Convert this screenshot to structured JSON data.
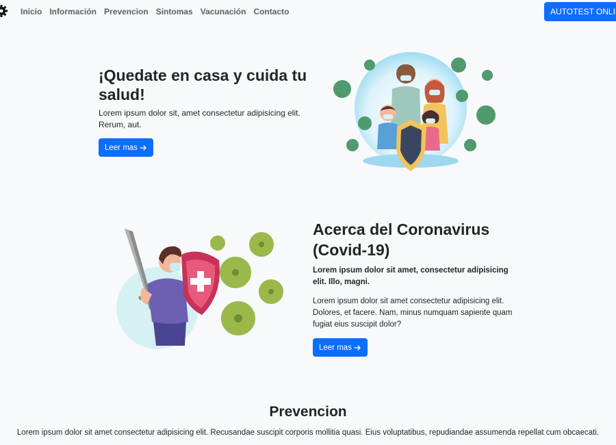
{
  "navbar": {
    "links": [
      "Inicio",
      "Información",
      "Prevencion",
      "Sintomas",
      "Vacunación",
      "Contacto"
    ],
    "cta_label": "AUTOTEST ONLINE"
  },
  "hero": {
    "title": "¡Quedate en casa y cuida tu salud!",
    "text": "Lorem ipsum dolor sit, amet consectetur adipisicing elit. Rerum, aut.",
    "button_label": "Leer mas"
  },
  "about": {
    "title": "Acerca del Coronavirus (Covid-19)",
    "lead": "Lorem ipsum dolor sit amet, consectetur adipisicing elit. Illo, magni.",
    "text": "Lorem ipsum dolor sit amet consectetur adipisicing elit. Dolores, et facere. Nam, minus numquam sapiente quam fugiat eius suscipit dolor?",
    "button_label": "Leer mas"
  },
  "prevention": {
    "title": "Prevencion",
    "text": "Lorem ipsum dolor sit amet consectetur adipisicing elit. Recusandae suscipit corporis mollitia quasi. Eius voluptatibus, repudiandae assumenda repellat cum obcaecati."
  },
  "colors": {
    "primary": "#0d6efd",
    "background": "#f8f9fa",
    "virus_green": "#4f9a6e",
    "virus_olive": "#9bb84a",
    "shield_red": "#c8325a"
  },
  "icons": {
    "brand": "gear-icon",
    "button_arrow": "arrow-right-icon"
  }
}
